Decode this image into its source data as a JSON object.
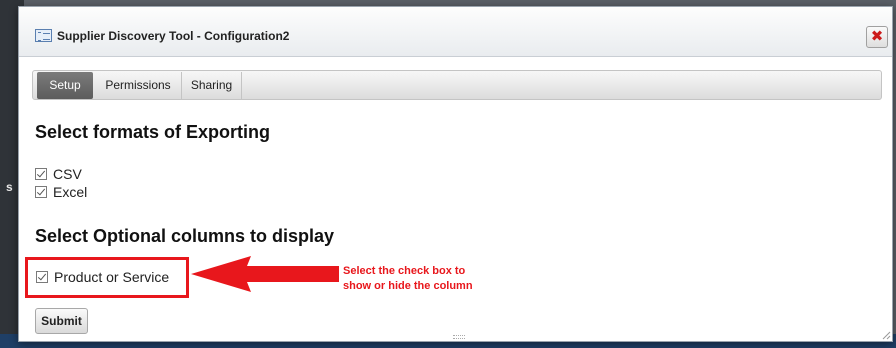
{
  "dialog": {
    "title": "Supplier Discovery Tool - Configuration2",
    "close_label": "✖"
  },
  "tabs": [
    {
      "label": "Setup",
      "active": true
    },
    {
      "label": "Permissions",
      "active": false
    },
    {
      "label": "Sharing",
      "active": false
    }
  ],
  "export_section": {
    "heading": "Select formats of Exporting",
    "options": [
      {
        "label": "CSV",
        "checked": true
      },
      {
        "label": "Excel",
        "checked": true
      }
    ]
  },
  "columns_section": {
    "heading": "Select Optional columns to display",
    "options": [
      {
        "label": "Product or Service",
        "checked": true
      }
    ]
  },
  "annotation": {
    "line1": "Select the check box to",
    "line2": "show or hide the column",
    "color": "#e8171c"
  },
  "submit_label": "Submit",
  "background_fragment": "s"
}
